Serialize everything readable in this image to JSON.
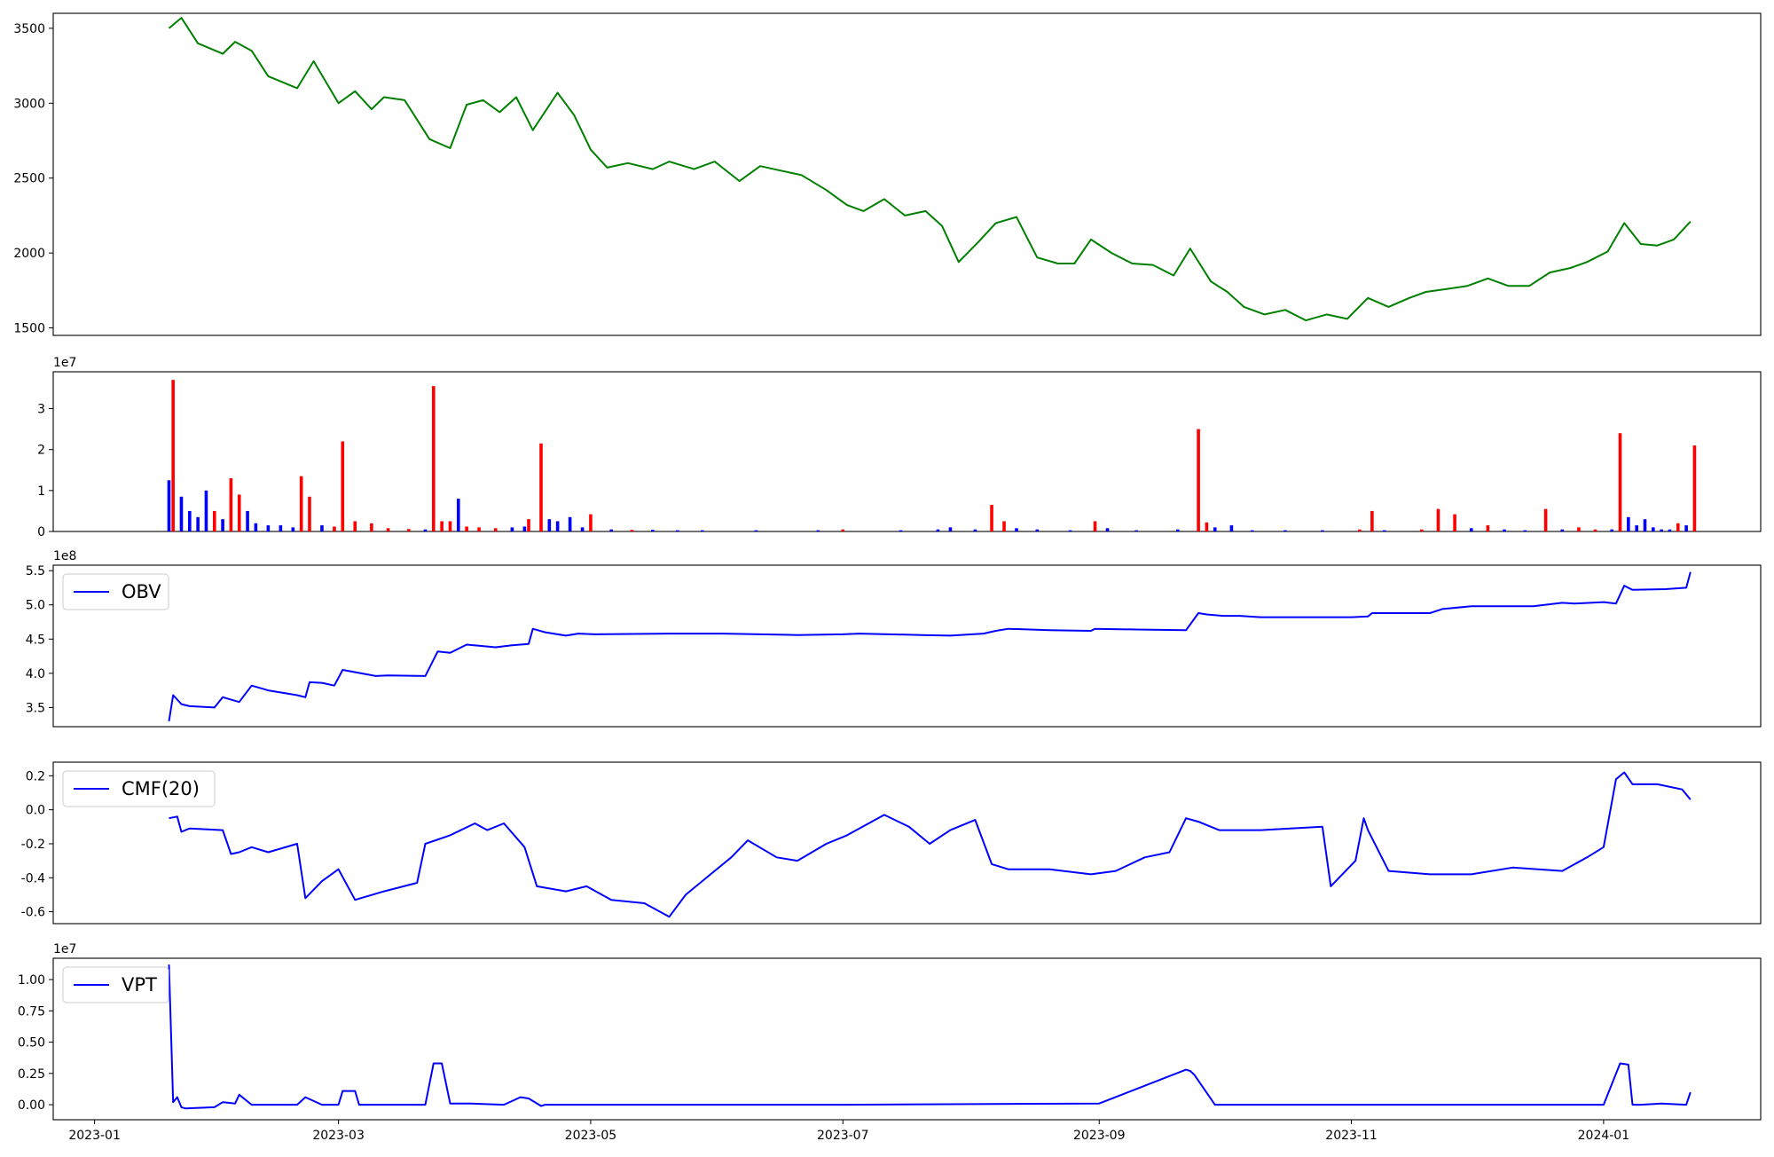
{
  "chart_data": [
    {
      "type": "line",
      "title": "",
      "xlabel": "",
      "ylabel": "",
      "ylim": [
        1450,
        3600
      ],
      "y_ticks": [
        "1500",
        "2000",
        "2500",
        "3000",
        "3500"
      ],
      "color": "#008000",
      "series": [
        {
          "x": [
            "2023-01-19",
            "2023-01-22",
            "2023-01-26",
            "2023-02-01",
            "2023-02-04",
            "2023-02-08",
            "2023-02-12",
            "2023-02-19",
            "2023-02-23",
            "2023-03-01",
            "2023-03-05",
            "2023-03-09",
            "2023-03-12",
            "2023-03-17",
            "2023-03-23",
            "2023-03-28",
            "2023-04-01",
            "2023-04-05",
            "2023-04-09",
            "2023-04-13",
            "2023-04-17",
            "2023-04-23",
            "2023-04-27",
            "2023-05-01",
            "2023-05-05",
            "2023-05-10",
            "2023-05-16",
            "2023-05-20",
            "2023-05-26",
            "2023-05-31",
            "2023-06-06",
            "2023-06-11",
            "2023-06-16",
            "2023-06-21",
            "2023-06-27",
            "2023-07-02",
            "2023-07-06",
            "2023-07-11",
            "2023-07-16",
            "2023-07-21",
            "2023-07-25",
            "2023-07-29",
            "2023-08-03",
            "2023-08-07",
            "2023-08-12",
            "2023-08-17",
            "2023-08-22",
            "2023-08-26",
            "2023-08-30",
            "2023-09-04",
            "2023-09-09",
            "2023-09-14",
            "2023-09-19",
            "2023-09-23",
            "2023-09-28",
            "2023-10-02",
            "2023-10-06",
            "2023-10-11",
            "2023-10-16",
            "2023-10-21",
            "2023-10-26",
            "2023-10-31",
            "2023-11-05",
            "2023-11-10",
            "2023-11-15",
            "2023-11-19",
            "2023-11-24",
            "2023-11-29",
            "2023-12-04",
            "2023-12-09",
            "2023-12-14",
            "2023-12-19",
            "2023-12-24",
            "2023-12-28",
            "2024-01-02",
            "2024-01-06",
            "2024-01-10",
            "2024-01-14",
            "2024-01-18",
            "2024-01-22"
          ],
          "y": [
            3500,
            3570,
            3400,
            3330,
            3410,
            3350,
            3180,
            3100,
            3280,
            3000,
            3080,
            2960,
            3040,
            3020,
            2760,
            2700,
            2990,
            3020,
            2940,
            3040,
            2820,
            3070,
            2920,
            2690,
            2570,
            2600,
            2560,
            2610,
            2560,
            2610,
            2480,
            2580,
            2550,
            2520,
            2420,
            2320,
            2280,
            2360,
            2250,
            2280,
            2180,
            1940,
            2080,
            2200,
            2240,
            1970,
            1930,
            1930,
            2090,
            2000,
            1930,
            1920,
            1850,
            2030,
            1810,
            1740,
            1640,
            1590,
            1620,
            1550,
            1590,
            1560,
            1700,
            1640,
            1700,
            1740,
            1760,
            1780,
            1830,
            1780,
            1780,
            1870,
            1900,
            1940,
            2010,
            2200,
            2060,
            2050,
            2090,
            2210
          ]
        }
      ]
    },
    {
      "type": "bar",
      "title": "",
      "xlabel": "",
      "ylabel": "",
      "multiplier": "1e7",
      "ylim": [
        0,
        3.9
      ],
      "y_ticks": [
        "0",
        "1",
        "2",
        "3"
      ],
      "colors": {
        "up": "#ff0000",
        "down": "#0000ff"
      },
      "series": [
        {
          "x": [
            "2023-01-19",
            "2023-01-20",
            "2023-01-22",
            "2023-01-24",
            "2023-01-26",
            "2023-01-28",
            "2023-01-30",
            "2023-02-01",
            "2023-02-03",
            "2023-02-05",
            "2023-02-07",
            "2023-02-09",
            "2023-02-12",
            "2023-02-15",
            "2023-02-18",
            "2023-02-20",
            "2023-02-22",
            "2023-02-25",
            "2023-02-28",
            "2023-03-02",
            "2023-03-05",
            "2023-03-09",
            "2023-03-13",
            "2023-03-18",
            "2023-03-22",
            "2023-03-24",
            "2023-03-26",
            "2023-03-28",
            "2023-03-30",
            "2023-04-01",
            "2023-04-04",
            "2023-04-08",
            "2023-04-12",
            "2023-04-15",
            "2023-04-16",
            "2023-04-19",
            "2023-04-21",
            "2023-04-23",
            "2023-04-26",
            "2023-04-29",
            "2023-05-01",
            "2023-05-06",
            "2023-05-11",
            "2023-05-16",
            "2023-05-22",
            "2023-05-28",
            "2023-06-10",
            "2023-06-25",
            "2023-07-01",
            "2023-07-15",
            "2023-07-24",
            "2023-07-27",
            "2023-08-02",
            "2023-08-06",
            "2023-08-09",
            "2023-08-12",
            "2023-08-17",
            "2023-08-25",
            "2023-08-31",
            "2023-09-03",
            "2023-09-10",
            "2023-09-20",
            "2023-09-25",
            "2023-09-27",
            "2023-09-29",
            "2023-10-03",
            "2023-10-08",
            "2023-10-16",
            "2023-10-25",
            "2023-11-03",
            "2023-11-06",
            "2023-11-09",
            "2023-11-18",
            "2023-11-22",
            "2023-11-26",
            "2023-11-30",
            "2023-12-04",
            "2023-12-08",
            "2023-12-13",
            "2023-12-18",
            "2023-12-22",
            "2023-12-26",
            "2023-12-30",
            "2024-01-03",
            "2024-01-05",
            "2024-01-07",
            "2024-01-09",
            "2024-01-11",
            "2024-01-13",
            "2024-01-15",
            "2024-01-17",
            "2024-01-19",
            "2024-01-21",
            "2024-01-23"
          ],
          "y": [
            1.25,
            3.7,
            0.85,
            0.5,
            0.35,
            1.0,
            0.5,
            0.3,
            1.3,
            0.9,
            0.5,
            0.2,
            0.15,
            0.15,
            0.1,
            1.35,
            0.85,
            0.15,
            0.12,
            2.2,
            0.25,
            0.2,
            0.08,
            0.06,
            0.05,
            3.55,
            0.25,
            0.25,
            0.8,
            0.12,
            0.1,
            0.08,
            0.1,
            0.12,
            0.3,
            2.15,
            0.3,
            0.25,
            0.35,
            0.1,
            0.42,
            0.05,
            0.04,
            0.04,
            0.03,
            0.03,
            0.03,
            0.03,
            0.05,
            0.03,
            0.05,
            0.1,
            0.05,
            0.65,
            0.25,
            0.08,
            0.05,
            0.03,
            0.25,
            0.08,
            0.03,
            0.05,
            2.5,
            0.22,
            0.1,
            0.15,
            0.03,
            0.03,
            0.03,
            0.05,
            0.5,
            0.03,
            0.05,
            0.55,
            0.42,
            0.08,
            0.15,
            0.05,
            0.03,
            0.55,
            0.05,
            0.1,
            0.05,
            0.05,
            2.4,
            0.35,
            0.15,
            0.3,
            0.1,
            0.05,
            0.05,
            0.2,
            0.15,
            2.1
          ],
          "up": [
            false,
            true,
            false,
            false,
            false,
            false,
            true,
            false,
            true,
            true,
            false,
            false,
            false,
            false,
            false,
            true,
            true,
            false,
            true,
            true,
            true,
            true,
            true,
            true,
            false,
            true,
            true,
            true,
            false,
            true,
            true,
            true,
            false,
            false,
            true,
            true,
            false,
            false,
            false,
            false,
            true,
            false,
            true,
            false,
            false,
            false,
            false,
            false,
            true,
            false,
            false,
            false,
            false,
            true,
            true,
            false,
            false,
            false,
            true,
            false,
            false,
            false,
            true,
            true,
            false,
            false,
            false,
            false,
            false,
            true,
            true,
            false,
            true,
            true,
            true,
            false,
            true,
            false,
            false,
            true,
            false,
            true,
            true,
            false,
            true,
            false,
            false,
            false,
            false,
            false,
            false,
            true,
            false,
            true
          ]
        }
      ]
    },
    {
      "type": "line",
      "title": "",
      "xlabel": "",
      "ylabel": "",
      "multiplier": "1e8",
      "ylim": [
        3.22,
        5.58
      ],
      "y_ticks": [
        "3.5",
        "4.0",
        "4.5",
        "5.0",
        "5.5"
      ],
      "legend": "top-left",
      "color": "#0000ff",
      "series": [
        {
          "name": "OBV",
          "x": [
            "2023-01-19",
            "2023-01-20",
            "2023-01-22",
            "2023-01-24",
            "2023-01-30",
            "2023-02-01",
            "2023-02-05",
            "2023-02-08",
            "2023-02-12",
            "2023-02-19",
            "2023-02-21",
            "2023-02-22",
            "2023-02-25",
            "2023-02-28",
            "2023-03-02",
            "2023-03-10",
            "2023-03-13",
            "2023-03-22",
            "2023-03-25",
            "2023-03-28",
            "2023-04-01",
            "2023-04-08",
            "2023-04-12",
            "2023-04-16",
            "2023-04-17",
            "2023-04-20",
            "2023-04-25",
            "2023-04-28",
            "2023-05-02",
            "2023-05-20",
            "2023-06-02",
            "2023-06-20",
            "2023-07-01",
            "2023-07-05",
            "2023-07-20",
            "2023-07-27",
            "2023-08-04",
            "2023-08-07",
            "2023-08-10",
            "2023-08-20",
            "2023-08-30",
            "2023-08-31",
            "2023-09-10",
            "2023-09-22",
            "2023-09-25",
            "2023-09-27",
            "2023-10-01",
            "2023-10-05",
            "2023-10-10",
            "2023-10-20",
            "2023-11-01",
            "2023-11-05",
            "2023-11-06",
            "2023-11-20",
            "2023-11-23",
            "2023-11-30",
            "2023-12-01",
            "2023-12-15",
            "2023-12-22",
            "2023-12-25",
            "2024-01-01",
            "2024-01-04",
            "2024-01-06",
            "2024-01-08",
            "2024-01-16",
            "2024-01-21",
            "2024-01-22"
          ],
          "y": [
            3.3,
            3.68,
            3.55,
            3.52,
            3.5,
            3.65,
            3.58,
            3.82,
            3.75,
            3.68,
            3.65,
            3.87,
            3.86,
            3.82,
            4.05,
            3.96,
            3.97,
            3.96,
            4.32,
            4.3,
            4.42,
            4.38,
            4.41,
            4.43,
            4.65,
            4.6,
            4.55,
            4.58,
            4.57,
            4.58,
            4.58,
            4.56,
            4.57,
            4.58,
            4.56,
            4.55,
            4.58,
            4.62,
            4.65,
            4.63,
            4.62,
            4.65,
            4.64,
            4.63,
            4.88,
            4.86,
            4.84,
            4.84,
            4.82,
            4.82,
            4.82,
            4.83,
            4.88,
            4.88,
            4.94,
            4.98,
            4.98,
            4.98,
            5.03,
            5.02,
            5.04,
            5.02,
            5.28,
            5.22,
            5.23,
            5.25,
            5.48
          ]
        }
      ]
    },
    {
      "type": "line",
      "title": "",
      "xlabel": "",
      "ylabel": "",
      "ylim": [
        -0.67,
        0.28
      ],
      "y_ticks": [
        "-0.6",
        "-0.4",
        "-0.2",
        "0.0",
        "0.2"
      ],
      "legend": "top-left",
      "color": "#0000ff",
      "series": [
        {
          "name": "CMF(20)",
          "x": [
            "2023-01-19",
            "2023-01-21",
            "2023-01-22",
            "2023-01-24",
            "2023-02-01",
            "2023-02-03",
            "2023-02-05",
            "2023-02-08",
            "2023-02-12",
            "2023-02-19",
            "2023-02-21",
            "2023-02-25",
            "2023-03-01",
            "2023-03-05",
            "2023-03-12",
            "2023-03-20",
            "2023-03-22",
            "2023-03-28",
            "2023-04-03",
            "2023-04-06",
            "2023-04-10",
            "2023-04-15",
            "2023-04-18",
            "2023-04-25",
            "2023-04-30",
            "2023-05-06",
            "2023-05-14",
            "2023-05-20",
            "2023-05-24",
            "2023-05-30",
            "2023-06-04",
            "2023-06-08",
            "2023-06-15",
            "2023-06-20",
            "2023-06-27",
            "2023-07-02",
            "2023-07-11",
            "2023-07-17",
            "2023-07-22",
            "2023-07-27",
            "2023-08-02",
            "2023-08-06",
            "2023-08-10",
            "2023-08-20",
            "2023-08-30",
            "2023-09-05",
            "2023-09-12",
            "2023-09-18",
            "2023-09-22",
            "2023-09-25",
            "2023-09-30",
            "2023-10-10",
            "2023-10-25",
            "2023-10-27",
            "2023-10-31",
            "2023-11-02",
            "2023-11-04",
            "2023-11-05",
            "2023-11-10",
            "2023-11-20",
            "2023-11-30",
            "2023-12-10",
            "2023-12-22",
            "2023-12-28",
            "2024-01-01",
            "2024-01-04",
            "2024-01-06",
            "2024-01-08",
            "2024-01-14",
            "2024-01-20",
            "2024-01-22"
          ],
          "y": [
            -0.05,
            -0.04,
            -0.13,
            -0.11,
            -0.12,
            -0.26,
            -0.25,
            -0.22,
            -0.25,
            -0.2,
            -0.52,
            -0.42,
            -0.35,
            -0.53,
            -0.48,
            -0.43,
            -0.2,
            -0.15,
            -0.08,
            -0.12,
            -0.08,
            -0.22,
            -0.45,
            -0.48,
            -0.45,
            -0.53,
            -0.55,
            -0.63,
            -0.5,
            -0.38,
            -0.28,
            -0.18,
            -0.28,
            -0.3,
            -0.2,
            -0.15,
            -0.03,
            -0.1,
            -0.2,
            -0.12,
            -0.06,
            -0.32,
            -0.35,
            -0.35,
            -0.38,
            -0.36,
            -0.28,
            -0.25,
            -0.05,
            -0.07,
            -0.12,
            -0.12,
            -0.1,
            -0.45,
            -0.35,
            -0.3,
            -0.05,
            -0.12,
            -0.36,
            -0.38,
            -0.38,
            -0.34,
            -0.36,
            -0.28,
            -0.22,
            0.18,
            0.22,
            0.15,
            0.15,
            0.12,
            0.06
          ]
        }
      ]
    },
    {
      "type": "line",
      "title": "",
      "xlabel": "",
      "ylabel": "",
      "multiplier": "1e7",
      "ylim": [
        -0.12,
        1.17
      ],
      "y_ticks": [
        "0.00",
        "0.25",
        "0.50",
        "0.75",
        "1.00"
      ],
      "legend": "top-left",
      "color": "#0000ff",
      "x_ticks": [
        "2023-01",
        "2023-03",
        "2023-05",
        "2023-07",
        "2023-09",
        "2023-11",
        "2024-01"
      ],
      "series": [
        {
          "name": "VPT",
          "x": [
            "2023-01-19",
            "2023-01-20",
            "2023-01-21",
            "2023-01-22",
            "2023-01-23",
            "2023-01-30",
            "2023-02-01",
            "2023-02-04",
            "2023-02-05",
            "2023-02-08",
            "2023-02-19",
            "2023-02-21",
            "2023-02-25",
            "2023-03-01",
            "2023-03-02",
            "2023-03-05",
            "2023-03-06",
            "2023-03-22",
            "2023-03-24",
            "2023-03-26",
            "2023-03-28",
            "2023-04-02",
            "2023-04-10",
            "2023-04-14",
            "2023-04-16",
            "2023-04-19",
            "2023-04-20",
            "2023-05-01",
            "2023-07-01",
            "2023-09-01",
            "2023-09-22",
            "2023-09-23",
            "2023-09-24",
            "2023-09-29",
            "2023-10-05",
            "2024-01-01",
            "2024-01-05",
            "2024-01-07",
            "2024-01-08",
            "2024-01-10",
            "2024-01-15",
            "2024-01-21",
            "2024-01-22"
          ],
          "y": [
            1.12,
            0.02,
            0.06,
            -0.02,
            -0.03,
            -0.02,
            0.02,
            0.01,
            0.08,
            0.0,
            0.0,
            0.06,
            0.0,
            0.0,
            0.11,
            0.11,
            0.0,
            0.0,
            0.33,
            0.33,
            0.01,
            0.01,
            0.0,
            0.06,
            0.05,
            -0.01,
            0.0,
            0.0,
            0.0,
            0.01,
            0.28,
            0.27,
            0.24,
            0.0,
            0.0,
            0.0,
            0.33,
            0.32,
            0.0,
            0.0,
            0.01,
            0.0,
            0.1
          ]
        }
      ]
    }
  ]
}
